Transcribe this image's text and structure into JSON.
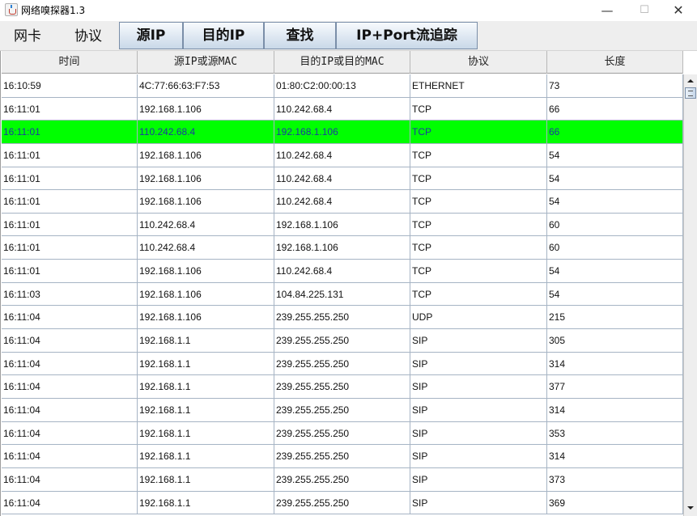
{
  "window": {
    "title": "网络嗅探器1.3",
    "minimize_glyph": "—",
    "maximize_glyph": "☐",
    "close_glyph": "✕"
  },
  "menu": {
    "items": [
      "网卡",
      "协议"
    ]
  },
  "toolbar": {
    "buttons": [
      "源IP",
      "目的IP",
      "查找",
      "IP+Port流追踪"
    ]
  },
  "table": {
    "columns": [
      "时间",
      "源IP或源MAC",
      "目的IP或目的MAC",
      "协议",
      "长度"
    ],
    "selected_row_index": 2,
    "selected_row_color": "#00ff00",
    "rows": [
      [
        "16:10:59",
        "4C:77:66:63:F7:53",
        "01:80:C2:00:00:13",
        "ETHERNET",
        "73"
      ],
      [
        "16:11:01",
        "192.168.1.106",
        "110.242.68.4",
        "TCP",
        "66"
      ],
      [
        "16:11:01",
        "110.242.68.4",
        "192.168.1.106",
        "TCP",
        "66"
      ],
      [
        "16:11:01",
        "192.168.1.106",
        "110.242.68.4",
        "TCP",
        "54"
      ],
      [
        "16:11:01",
        "192.168.1.106",
        "110.242.68.4",
        "TCP",
        "54"
      ],
      [
        "16:11:01",
        "192.168.1.106",
        "110.242.68.4",
        "TCP",
        "54"
      ],
      [
        "16:11:01",
        "110.242.68.4",
        "192.168.1.106",
        "TCP",
        "60"
      ],
      [
        "16:11:01",
        "110.242.68.4",
        "192.168.1.106",
        "TCP",
        "60"
      ],
      [
        "16:11:01",
        "192.168.1.106",
        "110.242.68.4",
        "TCP",
        "54"
      ],
      [
        "16:11:03",
        "192.168.1.106",
        "104.84.225.131",
        "TCP",
        "54"
      ],
      [
        "16:11:04",
        "192.168.1.106",
        "239.255.255.250",
        "UDP",
        "215"
      ],
      [
        "16:11:04",
        "192.168.1.1",
        "239.255.255.250",
        "SIP",
        "305"
      ],
      [
        "16:11:04",
        "192.168.1.1",
        "239.255.255.250",
        "SIP",
        "314"
      ],
      [
        "16:11:04",
        "192.168.1.1",
        "239.255.255.250",
        "SIP",
        "377"
      ],
      [
        "16:11:04",
        "192.168.1.1",
        "239.255.255.250",
        "SIP",
        "314"
      ],
      [
        "16:11:04",
        "192.168.1.1",
        "239.255.255.250",
        "SIP",
        "353"
      ],
      [
        "16:11:04",
        "192.168.1.1",
        "239.255.255.250",
        "SIP",
        "314"
      ],
      [
        "16:11:04",
        "192.168.1.1",
        "239.255.255.250",
        "SIP",
        "373"
      ],
      [
        "16:11:04",
        "192.168.1.1",
        "239.255.255.250",
        "SIP",
        "369"
      ]
    ]
  },
  "icons": {
    "app": "java-cup-icon",
    "scroll_up": "arrow-up-icon",
    "scroll_down": "arrow-down-icon"
  }
}
